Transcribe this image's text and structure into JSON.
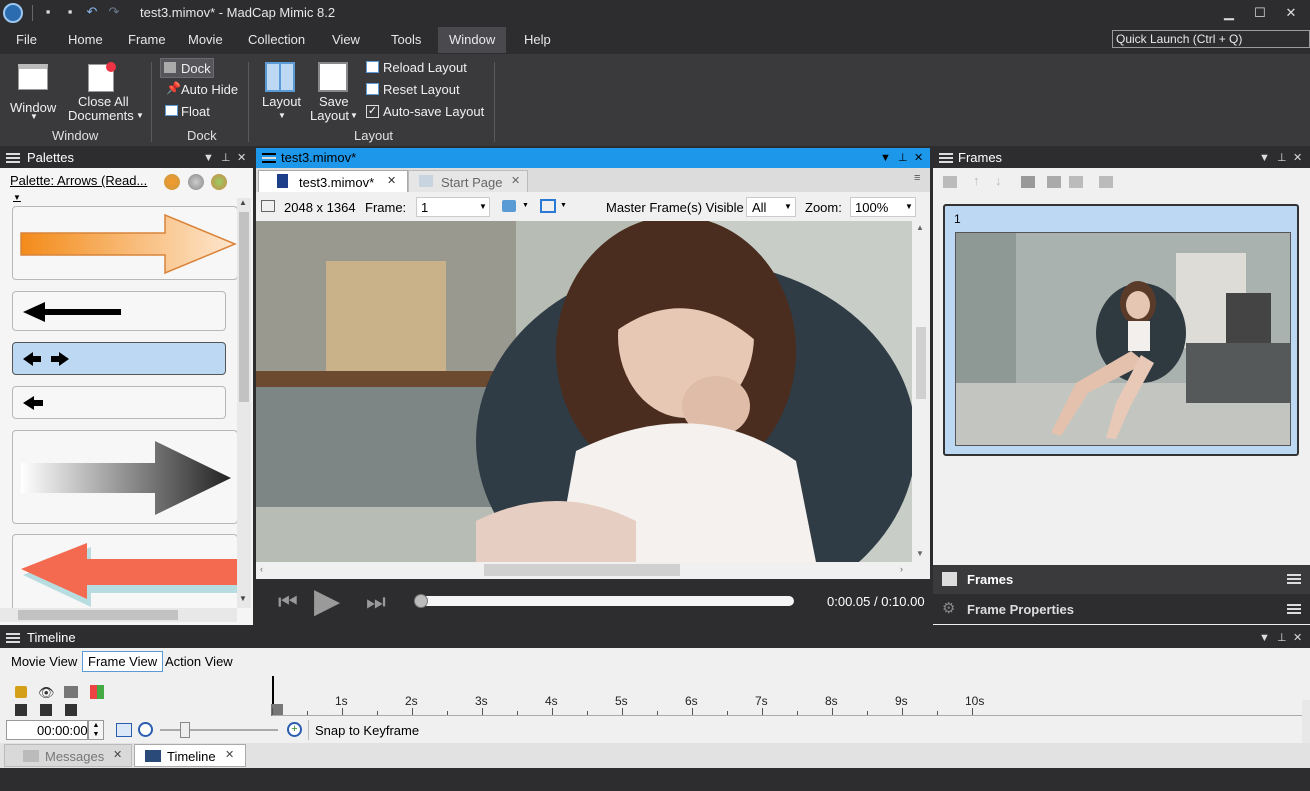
{
  "app": {
    "title": "test3.mimov* - MadCap Mimic 8.2",
    "window_controls": [
      "minimize-icon",
      "maximize-icon",
      "close-icon"
    ]
  },
  "menu": {
    "items": [
      "File",
      "Home",
      "Frame",
      "Movie",
      "Collection",
      "View",
      "Tools",
      "Window",
      "Help"
    ],
    "active": "Window",
    "quick_launch": "Quick Launch (Ctrl + Q)"
  },
  "ribbon": {
    "window_group": {
      "window_label": "Window",
      "close_all_line1": "Close All",
      "close_all_line2": "Documents",
      "group_label": "Window"
    },
    "dock_group": {
      "dock": "Dock",
      "auto_hide": "Auto Hide",
      "float": "Float",
      "group_label": "Dock"
    },
    "layout_group": {
      "layout": "Layout",
      "save_line1": "Save",
      "save_line2": "Layout",
      "reload": "Reload Layout",
      "reset": "Reset Layout",
      "autosave": "Auto-save Layout",
      "group_label": "Layout"
    }
  },
  "palettes": {
    "title": "Palettes",
    "selector": "Palette: Arrows (Read...",
    "colors": {
      "orange": "#f39a2a",
      "red": "#f36a50",
      "selected": "#bcd8f3"
    }
  },
  "editor": {
    "doc_title": "test3.mimov*",
    "tabs": [
      {
        "label": "test3.mimov*",
        "active": true
      },
      {
        "label": "Start Page",
        "active": false
      }
    ],
    "size": "2048 x 1364",
    "frame_label": "Frame:",
    "frame_value": "1",
    "master_label": "Master Frame(s) Visible",
    "master_value": "All",
    "zoom_label": "Zoom:",
    "zoom_value": "100%",
    "time": "0:00.05 / 0:10.00",
    "progress": 0.005
  },
  "frames": {
    "title": "Frames",
    "frame_number": "1",
    "bottom_tabs": [
      "Frames",
      "Frame Properties"
    ]
  },
  "timeline": {
    "title": "Timeline",
    "views": [
      "Movie View",
      "Frame View",
      "Action View"
    ],
    "active_view": "Frame View",
    "ticks": [
      "1s",
      "2s",
      "3s",
      "4s",
      "5s",
      "6s",
      "7s",
      "8s",
      "9s",
      "10s"
    ],
    "time_value": "00:00:00",
    "snap": "Snap to Keyframe",
    "bottom_tabs": [
      "Messages",
      "Timeline"
    ]
  }
}
